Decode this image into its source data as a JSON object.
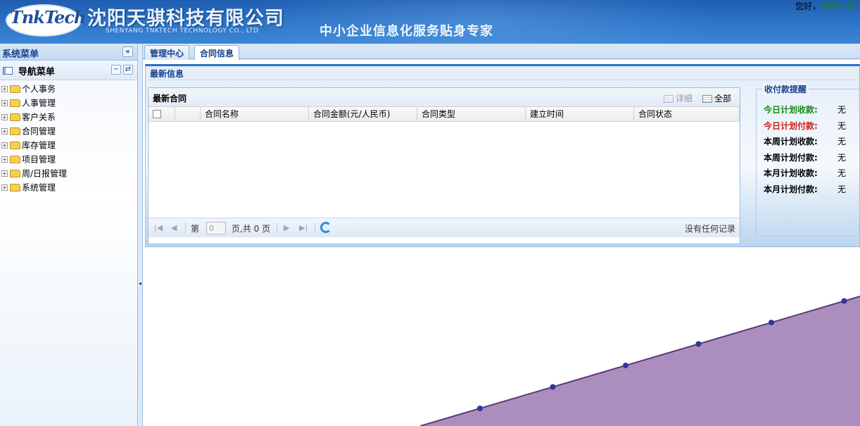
{
  "header": {
    "logo_text": "TnkTech",
    "company_name": "沈阳天骐科技有限公司",
    "company_name_en": "SHENYANG TNKTECH TECHNOLOGY CO., LTD",
    "slogan": "中小企业信息化服务贴身专家",
    "greeting": "您好，",
    "user": "试用人员,"
  },
  "sidebar": {
    "title": "系统菜单",
    "collapse_glyph": "«",
    "nav_title": "导航菜单",
    "collapse_all_glyph": "−",
    "refresh_glyph": "⇄",
    "items": [
      {
        "label": "个人事务"
      },
      {
        "label": "人事管理"
      },
      {
        "label": "客户关系"
      },
      {
        "label": "合同管理"
      },
      {
        "label": "库存管理"
      },
      {
        "label": "项目管理"
      },
      {
        "label": "周/日报管理"
      },
      {
        "label": "系统管理"
      }
    ]
  },
  "tabs": [
    {
      "label": "管理中心"
    },
    {
      "label": "合同信息"
    }
  ],
  "news": {
    "title": "最新信息",
    "contracts": {
      "title": "最新合同",
      "detail_button": "详细",
      "all_button": "全部",
      "columns": [
        {
          "label": ""
        },
        {
          "label": ""
        },
        {
          "label": "合同名称"
        },
        {
          "label": "合同金额(元/人民币)"
        },
        {
          "label": "合同类型"
        },
        {
          "label": "建立时间"
        },
        {
          "label": "合同状态"
        }
      ],
      "pager": {
        "page_prefix": "第",
        "page_value": "0",
        "page_suffix": "页,共 0 页",
        "no_records": "没有任何记录"
      }
    },
    "reminder": {
      "title": "收付款提醒",
      "rows": [
        {
          "label": "今日计划收款:",
          "value": "无",
          "color": "#1a8a1a"
        },
        {
          "label": "今日计划付款:",
          "value": "无",
          "color": "#cc1f1f"
        },
        {
          "label": "本周计划收款:",
          "value": "无",
          "color": "#000000"
        },
        {
          "label": "本周计划付款:",
          "value": "无",
          "color": "#000000"
        },
        {
          "label": "本月计划收款:",
          "value": "无",
          "color": "#000000"
        },
        {
          "label": "本月计划付款:",
          "value": "无",
          "color": "#000000"
        }
      ]
    }
  },
  "colors": {
    "header_blue": "#2b71c5",
    "panel_border": "#99bbe8",
    "title_blue": "#15428b",
    "area_fill": "#ab8ebd",
    "area_line": "#5a3a78",
    "point": "#34349c"
  },
  "chart_data": {
    "type": "area",
    "series": [
      {
        "values": [
          1,
          2,
          3,
          4,
          5,
          6
        ]
      }
    ]
  }
}
